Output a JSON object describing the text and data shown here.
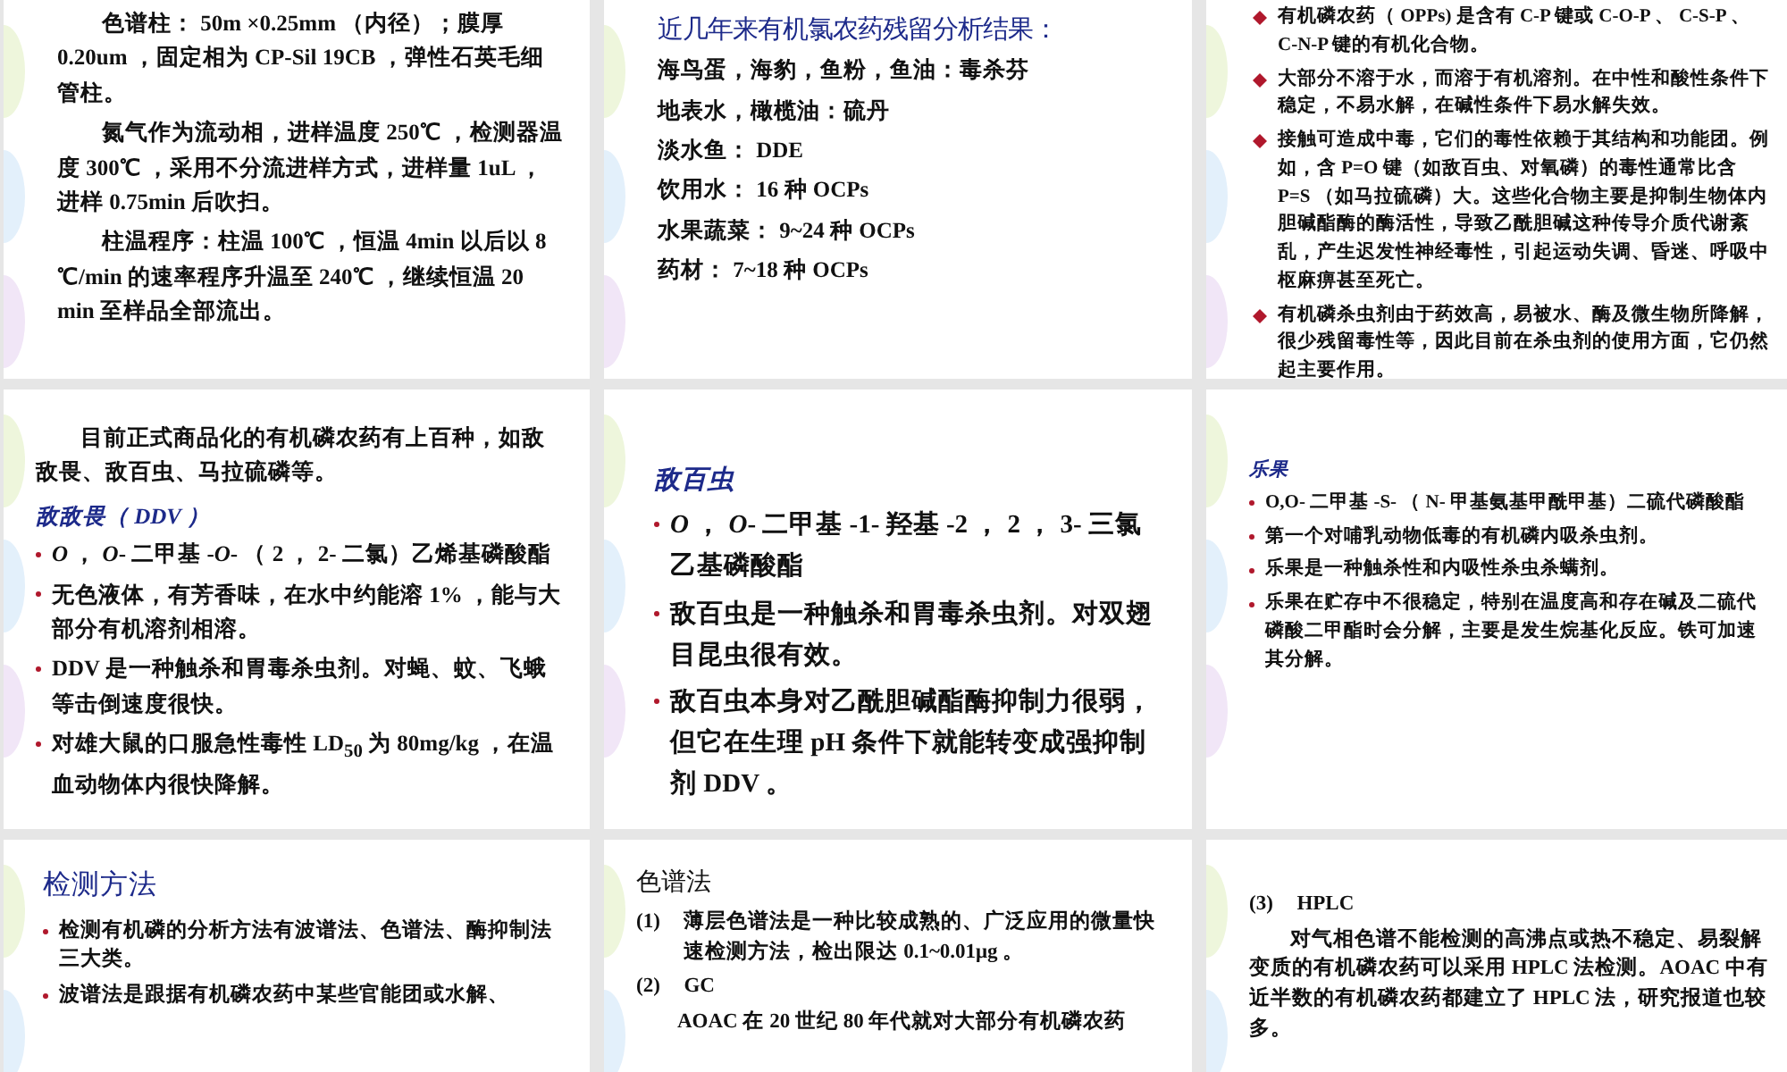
{
  "slides": [
    {
      "blocks": [
        {
          "kind": "para",
          "text": "色谱柱： 50m ×0.25mm （内径）；膜厚 0.20um ，固定相为 CP-Sil 19CB ，弹性石英毛细管柱。"
        },
        {
          "kind": "para",
          "text": "氮气作为流动相，进样温度 250℃ ，检测器温度 300℃ ，采用不分流进样方式，进样量 1uL ，进样 0.75min 后吹扫。"
        },
        {
          "kind": "para",
          "text": "柱温程序：柱温 100℃ ，恒温 4min 以后以 8 ℃/min 的速率程序升温至 240℃ ，继续恒温 20 min 至样品全部流出。"
        }
      ]
    },
    {
      "blocks": [
        {
          "kind": "heading",
          "text": "近几年来有机氯农药残留分析结果："
        },
        {
          "kind": "line",
          "text": "海鸟蛋，海豹，鱼粉，鱼油：毒杀芬"
        },
        {
          "kind": "line",
          "text": "地表水，橄榄油：硫丹"
        },
        {
          "kind": "line",
          "text": "淡水鱼： DDE"
        },
        {
          "kind": "line",
          "text": "饮用水： 16 种 OCPs"
        },
        {
          "kind": "line",
          "text": "水果蔬菜： 9~24 种 OCPs"
        },
        {
          "kind": "line",
          "text": "药材： 7~18 种 OCPs"
        }
      ]
    },
    {
      "blocks": [
        {
          "kind": "diamond",
          "text": "有机磷农药（ OPPs) 是含有 C-P 键或 C-O-P 、 C-S-P 、 C-N-P 键的有机化合物。"
        },
        {
          "kind": "diamond",
          "text": "大部分不溶于水，而溶于有机溶剂。在中性和酸性条件下稳定，不易水解，在碱性条件下易水解失效。"
        },
        {
          "kind": "diamond",
          "text": "接触可造成中毒，它们的毒性依赖于其结构和功能团。例如，含 P=O 键（如敌百虫、对氧磷）的毒性通常比含 P=S （如马拉硫磷）大。这些化合物主要是抑制生物体内胆碱酯酶的酶活性，导致乙酰胆碱这种传导介质代谢紊乱，产生迟发性神经毒性，引起运动失调、昏迷、呼吸中枢麻痹甚至死亡。"
        },
        {
          "kind": "diamond",
          "text": "有机磷杀虫剂由于药效高，易被水、酶及微生物所降解，很少残留毒性等，因此目前在杀虫剂的使用方面，它仍然起主要作用。"
        }
      ]
    },
    {
      "blocks": [
        {
          "kind": "para",
          "text": "目前正式商品化的有机磷农药有上百种，如敌敌畏、敌百虫、马拉硫磷等。"
        },
        {
          "kind": "subtitle",
          "text": "敌敌畏（ DDV ）"
        },
        {
          "kind": "bullet",
          "text": "*O* ， *O*- 二甲基 -*O*- （ 2 ， 2- 二氯）乙烯基磷酸酯"
        },
        {
          "kind": "bullet",
          "text": "无色液体，有芳香味，在水中约能溶 1% ，能与大部分有机溶剂相溶。"
        },
        {
          "kind": "bullet",
          "text": "DDV 是一种触杀和胃毒杀虫剂。对蝇、蚊、飞蛾等击倒速度很快。"
        },
        {
          "kind": "bullet",
          "text": "对雄大鼠的口服急性毒性 LD$_{50}$ 为 80mg/kg ，在温血动物体内很快降解。"
        }
      ]
    },
    {
      "blocks": [
        {
          "kind": "subtitle",
          "text": "敌百虫"
        },
        {
          "kind": "bullet",
          "text": "*O* ， *O*- 二甲基 -1- 羟基 -2 ， 2 ， 3- 三氯乙基磷酸酯"
        },
        {
          "kind": "bullet",
          "text": "敌百虫是一种触杀和胃毒杀虫剂。对双翅目昆虫很有效。"
        },
        {
          "kind": "bullet",
          "text": "敌百虫本身对乙酰胆碱酯酶抑制力很弱，但它在生理 pH 条件下就能转变成强抑制剂 DDV 。"
        }
      ]
    },
    {
      "blocks": [
        {
          "kind": "subtitle",
          "text": "乐果"
        },
        {
          "kind": "bullet",
          "text": "O,O- 二甲基 -S- （ N- 甲基氨基甲酰甲基）二硫代磷酸酯"
        },
        {
          "kind": "bullet",
          "text": "第一个对哺乳动物低毒的有机磷内吸杀虫剂。"
        },
        {
          "kind": "bullet",
          "text": "乐果是一种触杀性和内吸性杀虫杀螨剂。"
        },
        {
          "kind": "bullet",
          "text": "乐果在贮存中不很稳定，特别在温度高和存在碱及二硫代磷酸二甲酯时会分解，主要是发生烷基化反应。铁可加速其分解。"
        }
      ]
    },
    {
      "blocks": [
        {
          "kind": "title",
          "text": "检测方法"
        },
        {
          "kind": "bullet",
          "text": "检测有机磷的分析方法有波谱法、色谱法、酶抑制法三大类。"
        },
        {
          "kind": "bullet",
          "text": "波谱法是跟据有机磷农药中某些官能团或水解、"
        }
      ]
    },
    {
      "blocks": [
        {
          "kind": "heading-plain",
          "text": "色谱法"
        },
        {
          "kind": "numbered",
          "num": "(1)",
          "text": "薄层色谱法是一种比较成熟的、广泛应用的微量快速检测方法，检出限达 0.1~0.01μg 。"
        },
        {
          "kind": "numbered",
          "num": "(2)",
          "text": "GC"
        },
        {
          "kind": "para",
          "text": "AOAC 在 20 世纪 80 年代就对大部分有机磷农药"
        }
      ]
    },
    {
      "blocks": [
        {
          "kind": "numbered",
          "num": "(3)",
          "text": "HPLC"
        },
        {
          "kind": "para",
          "text": "对气相色谱不能检测的高沸点或热不稳定、易裂解变质的有机磷农药可以采用 HPLC 法检测。AOAC 中有近半数的有机磷农药都建立了 HPLC 法，研究报道也较多。"
        }
      ]
    }
  ]
}
